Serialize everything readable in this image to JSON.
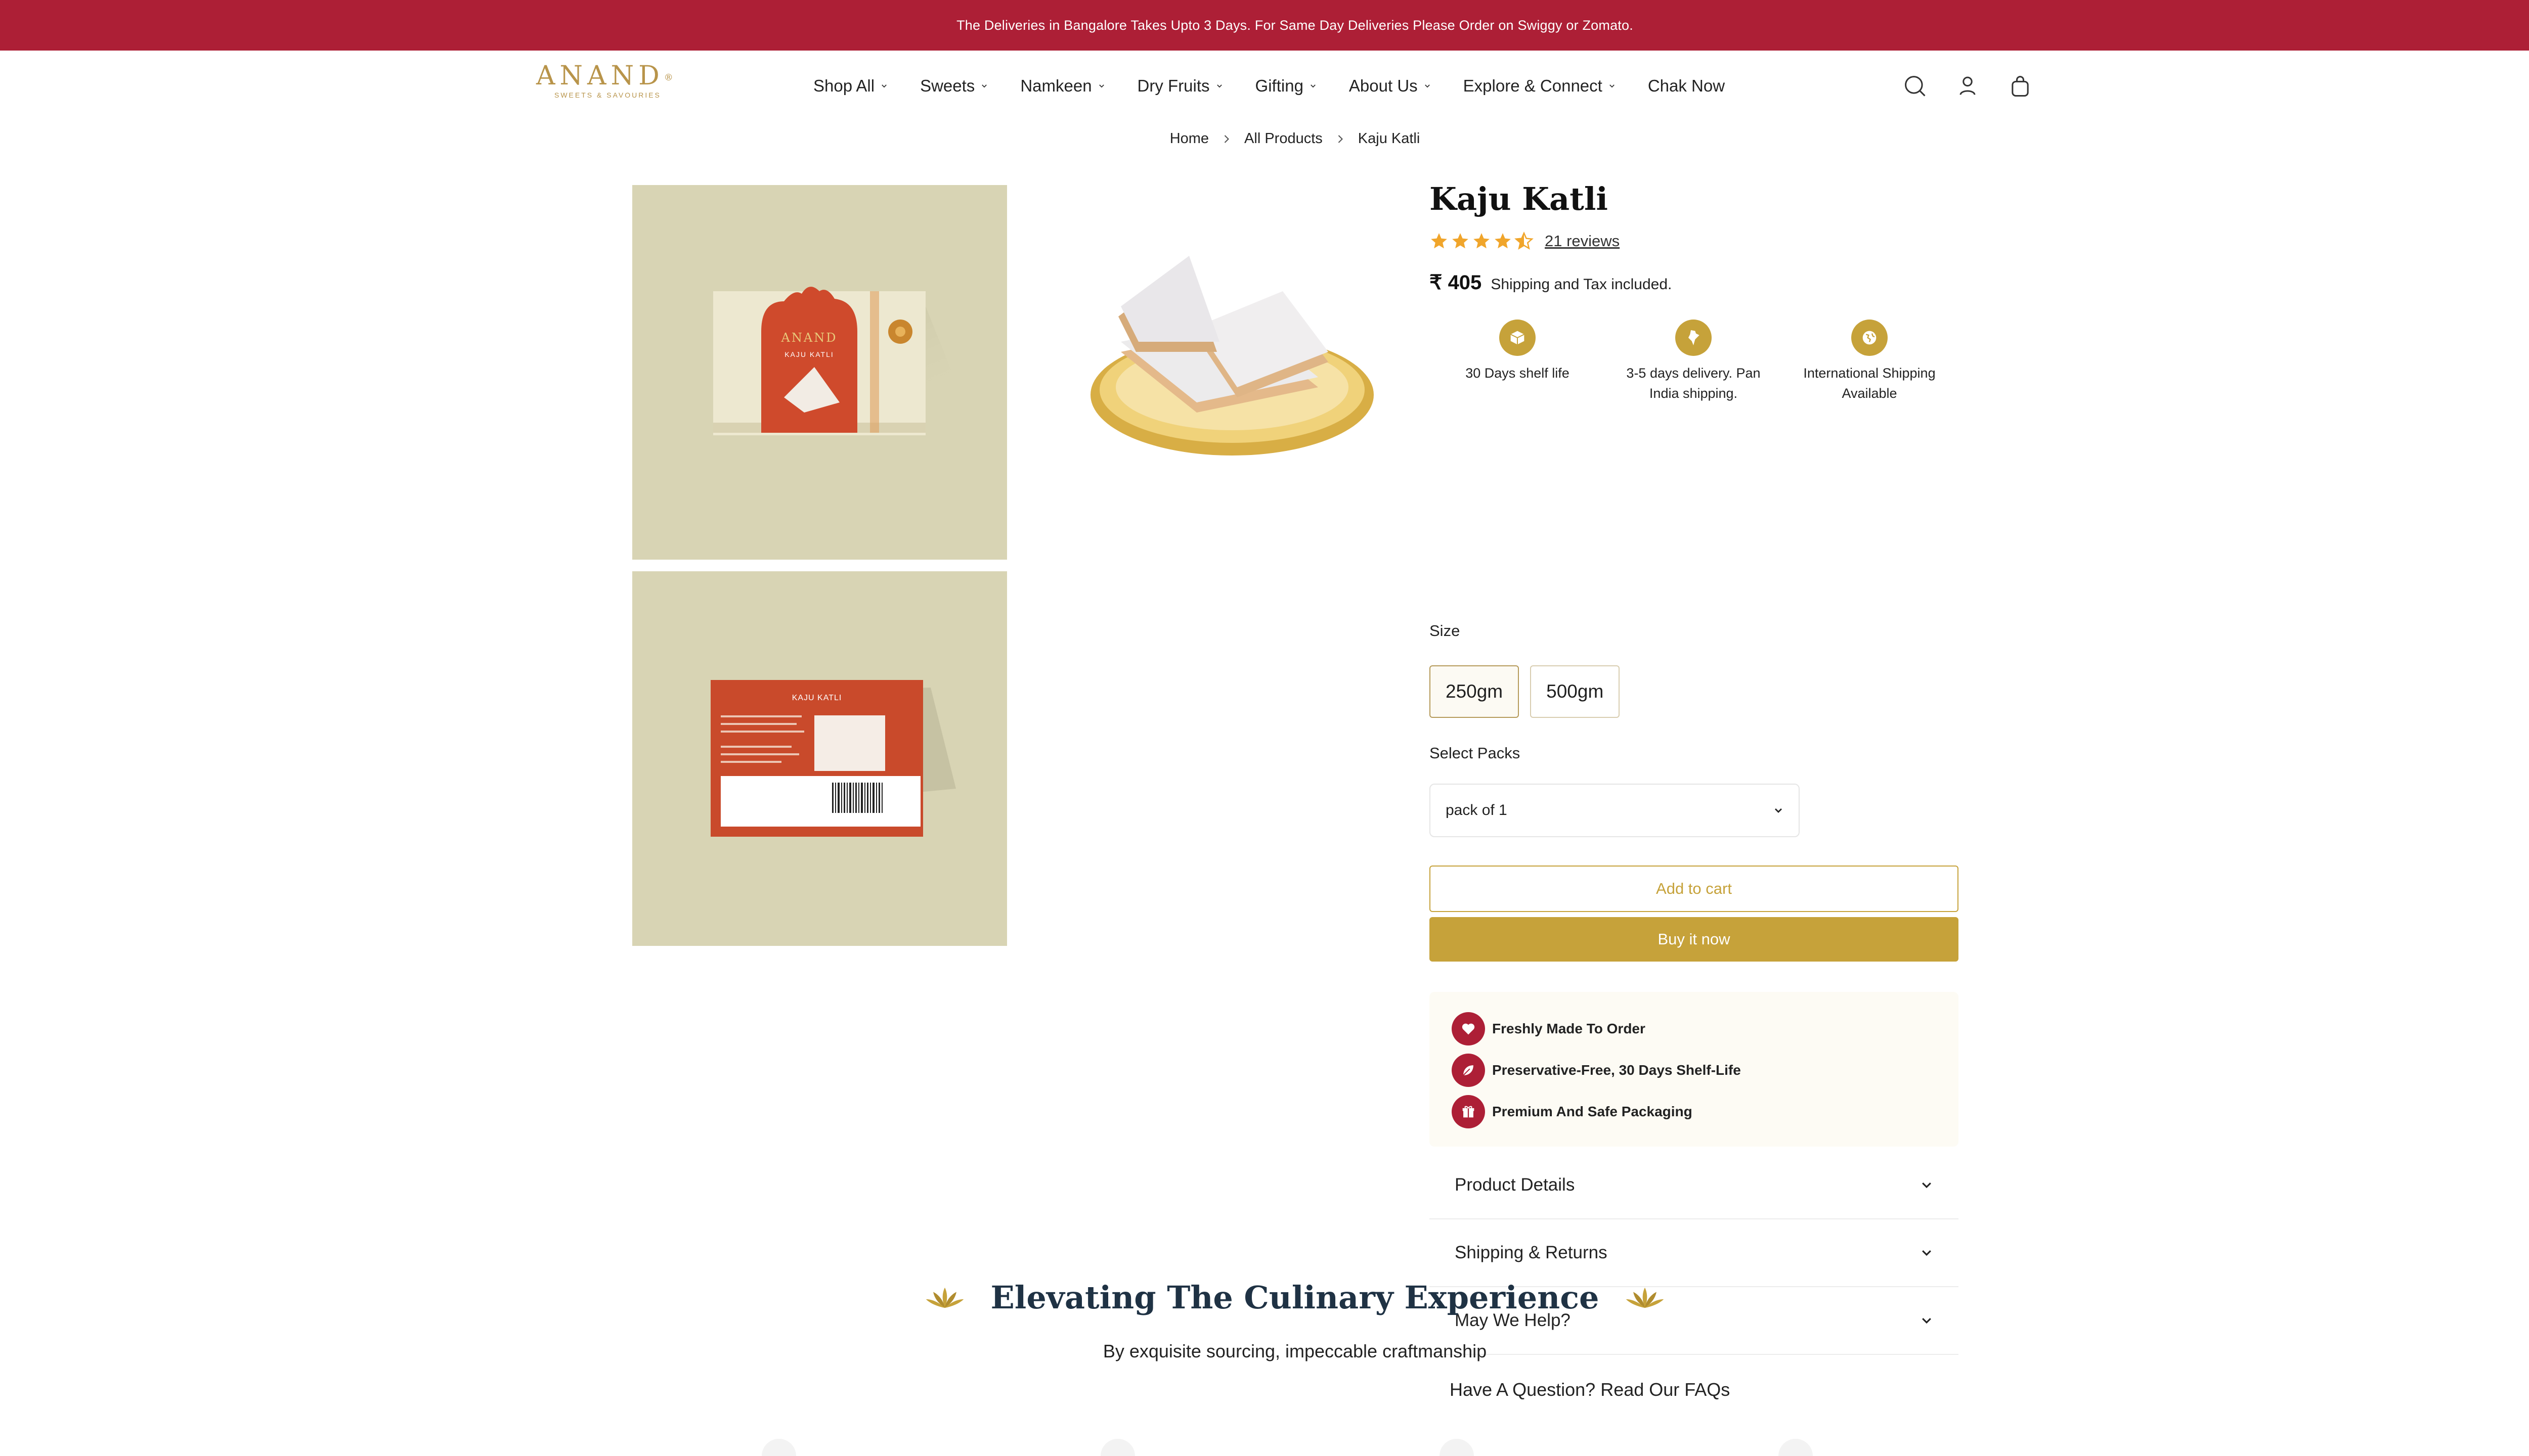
{
  "announcement": "The Deliveries in Bangalore Takes Upto 3 Days. For Same Day Deliveries Please Order on Swiggy or Zomato.",
  "brand": {
    "name": "ANAND",
    "tagline": "SWEETS & SAVOURIES",
    "color": "#b8944a"
  },
  "nav": [
    {
      "label": "Shop All",
      "dropdown": true
    },
    {
      "label": "Sweets",
      "dropdown": true
    },
    {
      "label": "Namkeen",
      "dropdown": true
    },
    {
      "label": "Dry Fruits",
      "dropdown": true
    },
    {
      "label": "Gifting",
      "dropdown": true
    },
    {
      "label": "About Us",
      "dropdown": true
    },
    {
      "label": "Explore & Connect",
      "dropdown": true
    },
    {
      "label": "Chak Now",
      "dropdown": false
    }
  ],
  "header_icons": [
    "search-icon",
    "account-icon",
    "cart-icon"
  ],
  "breadcrumb": [
    "Home",
    "All Products",
    "Kaju Katli"
  ],
  "gallery": {
    "box_label_brand": "ANAND",
    "box_label_product": "KAJU KATLI",
    "back_label": "KAJU KATLI"
  },
  "product": {
    "title": "Kaju Katli",
    "rating": 4.5,
    "reviews": "21 reviews",
    "price": "₹ 405",
    "tax_note": "Shipping and Tax included.",
    "features": [
      {
        "icon": "box-icon",
        "text": "30 Days shelf life"
      },
      {
        "icon": "india-map-icon",
        "text": "3-5 days delivery. Pan India shipping."
      },
      {
        "icon": "globe-icon",
        "text": "International Shipping Available"
      }
    ],
    "size_label": "Size",
    "sizes": [
      "250gm",
      "500gm"
    ],
    "selected_size": "250gm",
    "packs_label": "Select Packs",
    "pack_selected": "pack of 1",
    "add_to_cart": "Add to cart",
    "buy_now": "Buy it now",
    "promises": [
      {
        "icon": "heart-icon",
        "text": "Freshly Made To Order"
      },
      {
        "icon": "leaf-icon",
        "text": "Preservative-Free, 30 Days Shelf-Life"
      },
      {
        "icon": "gift-icon",
        "text": "Premium And Safe Packaging"
      }
    ],
    "accordions": [
      "Product Details",
      "Shipping & Returns",
      "May We Help?"
    ],
    "faq": "Have A Question? Read Our FAQs"
  },
  "culinary": {
    "title": "Elevating The Culinary Experience",
    "subtitle": "By exquisite sourcing, impeccable craftmanship"
  },
  "colors": {
    "announcement_bg": "#ad1f36",
    "gold": "#c6a23a",
    "navy": "#1f3244",
    "promise_bg": "#fdfbf4"
  }
}
